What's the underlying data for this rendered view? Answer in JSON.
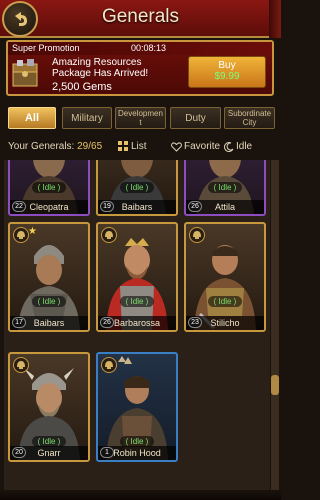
{
  "header": {
    "title": "Generals"
  },
  "promo": {
    "label": "Super Promotion",
    "timer": "00:08:13",
    "text": "Amazing Resources Package Has Arrived!",
    "gems": "2,500 Gems",
    "buy_label": "Buy",
    "buy_price": "$9.99"
  },
  "tabs": [
    {
      "label": "All",
      "active": true
    },
    {
      "label": "Military"
    },
    {
      "label": "Developmen t"
    },
    {
      "label": "Duty"
    },
    {
      "label": "Subordinate City"
    }
  ],
  "filters": {
    "count_label": "Your Generals:",
    "count": "29/65",
    "list_label": "List",
    "favorite_label": "Favorite",
    "idle_label": "Idle"
  },
  "generals": [
    {
      "name": "Cleopatra",
      "level": "22",
      "status": "Idle",
      "border": "purple"
    },
    {
      "name": "Baibars",
      "level": "19",
      "status": "Idle",
      "border": "gold"
    },
    {
      "name": "Attila",
      "level": "26",
      "status": "Idle",
      "border": "purple"
    },
    {
      "name": "Baibars",
      "level": "17",
      "status": "Idle",
      "border": "gold",
      "starred": true
    },
    {
      "name": "Barbarossa",
      "level": "26",
      "status": "Idle",
      "border": "gold"
    },
    {
      "name": "Stilicho",
      "level": "23",
      "status": "Idle",
      "border": "gold"
    },
    {
      "name": "Gnarr",
      "level": "20",
      "status": "Idle",
      "border": "gold"
    },
    {
      "name": "Robin Hood",
      "level": "1",
      "status": "Idle",
      "border": "blue"
    }
  ],
  "colors": {
    "header": "#8a1712",
    "accent": "#c8983e",
    "idle_text": "#78e06b",
    "price": "#7cff7c"
  }
}
